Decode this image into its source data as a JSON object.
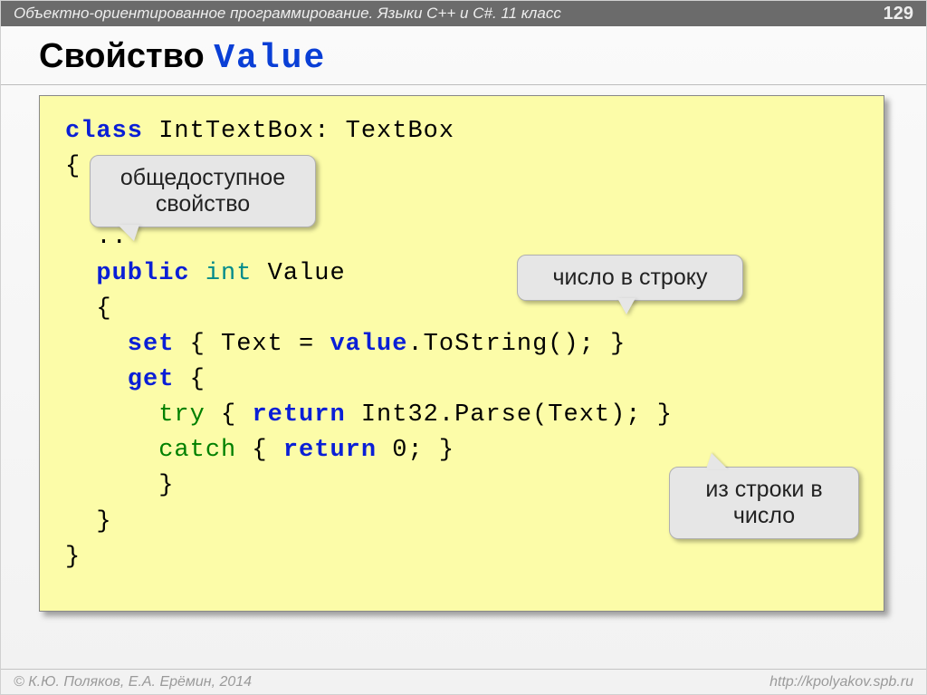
{
  "header": {
    "subject": "Объектно-ориентированное программирование. Языки C++ и C#. 11 класс",
    "page": "129"
  },
  "title_plain": "Свойство ",
  "title_code": "Value",
  "code": {
    "l1a": "class",
    "l1b": " IntTextBox: TextBox",
    "l2": "{",
    "l3": "  ..",
    "l4a": "  public",
    "l4b": " int",
    "l4c": " Value",
    "l5": "  {",
    "l6a": "    set",
    "l6b": " { Text = ",
    "l6c": "value",
    "l6d": ".ToString(); }",
    "l7a": "    get",
    "l7b": " {",
    "l8a": "      try",
    "l8b": " { ",
    "l8c": "return",
    "l8d": " Int32.Parse(Text); }",
    "l9a": "      catch",
    "l9b": " { ",
    "l9c": "return",
    "l9d": " 0; }",
    "l10": "      }",
    "l11": "  }",
    "l12": "}"
  },
  "callouts": {
    "public_property": "общедоступное свойство",
    "num_to_str": "число в строку",
    "str_to_num": "из строки в число"
  },
  "footer": {
    "left": "© К.Ю. Поляков, Е.А. Ерёмин, 2014",
    "right": "http://kpolyakov.spb.ru"
  }
}
